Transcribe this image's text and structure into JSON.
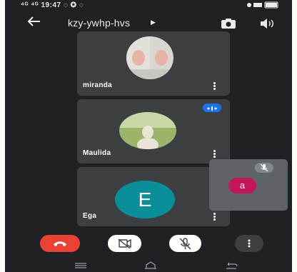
{
  "status": {
    "time_left": "19:47"
  },
  "header": {
    "meeting_code": "kzy-ywhp-hvs"
  },
  "participants": [
    {
      "name": "miranda"
    },
    {
      "name": "Maulida"
    },
    {
      "name": "Ega",
      "initial": "E",
      "avatar_color": "#0a8f9a"
    }
  ],
  "self_view": {
    "initial": "a",
    "avatar_color": "#c2185b"
  },
  "colors": {
    "end_call": "#ea4335",
    "speaking_badge": "#1a73e8",
    "background": "#202124",
    "tile": "#3c4043"
  }
}
